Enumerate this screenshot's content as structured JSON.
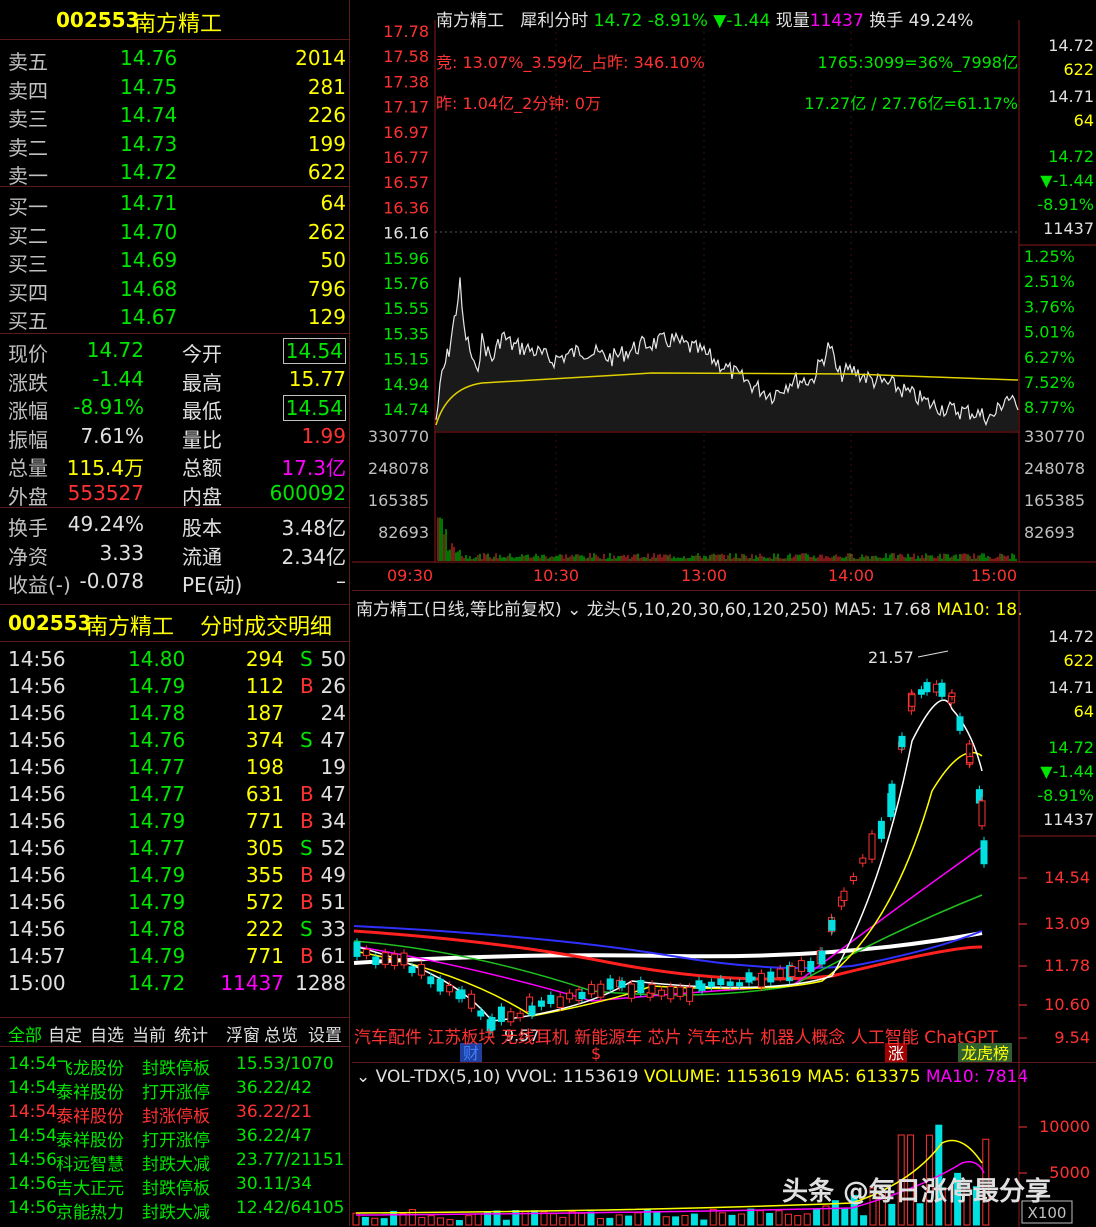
{
  "stock": {
    "code": "002553",
    "name": "南方精工"
  },
  "orderbook": {
    "asks": [
      {
        "label": "卖五",
        "price": "14.76",
        "vol": "2014"
      },
      {
        "label": "卖四",
        "price": "14.75",
        "vol": "281"
      },
      {
        "label": "卖三",
        "price": "14.74",
        "vol": "226"
      },
      {
        "label": "卖二",
        "price": "14.73",
        "vol": "199"
      },
      {
        "label": "卖一",
        "price": "14.72",
        "vol": "622"
      }
    ],
    "bids": [
      {
        "label": "买一",
        "price": "14.71",
        "vol": "64"
      },
      {
        "label": "买二",
        "price": "14.70",
        "vol": "262"
      },
      {
        "label": "买三",
        "price": "14.69",
        "vol": "50"
      },
      {
        "label": "买四",
        "price": "14.68",
        "vol": "796"
      },
      {
        "label": "买五",
        "price": "14.67",
        "vol": "129"
      }
    ]
  },
  "quote": [
    {
      "l1": "现价",
      "v1": "14.72",
      "l2": "今开",
      "v2": "14.54"
    },
    {
      "l1": "涨跌",
      "v1": "-1.44",
      "l2": "最高",
      "v2": "15.77"
    },
    {
      "l1": "涨幅",
      "v1": "-8.91%",
      "l2": "最低",
      "v2": "14.54"
    },
    {
      "l1": "振幅",
      "v1": "7.61%",
      "l2": "量比",
      "v2": "1.99"
    },
    {
      "l1": "总量",
      "v1": "115.4万",
      "l2": "总额",
      "v2": "17.3亿"
    },
    {
      "l1": "外盘",
      "v1": "553527",
      "l2": "内盘",
      "v2": "600092"
    },
    {
      "l1": "换手",
      "v1": "49.24%",
      "l2": "股本",
      "v2": "3.48亿"
    },
    {
      "l1": "净资",
      "v1": "3.33",
      "l2": "流通",
      "v2": "2.34亿"
    },
    {
      "l1": "收益(-)",
      "v1": "-0.078",
      "l2": "PE(动)",
      "v2": "–"
    }
  ],
  "ticks_header": {
    "code": "002553",
    "name": "南方精工",
    "title": "分时成交明细"
  },
  "ticks": [
    {
      "t": "14:56",
      "p": "14.80",
      "v": "294",
      "bs": "S",
      "n": "50"
    },
    {
      "t": "14:56",
      "p": "14.79",
      "v": "112",
      "bs": "B",
      "n": "26"
    },
    {
      "t": "14:56",
      "p": "14.78",
      "v": "187",
      "bs": "",
      "n": "24"
    },
    {
      "t": "14:56",
      "p": "14.76",
      "v": "374",
      "bs": "S",
      "n": "47"
    },
    {
      "t": "14:56",
      "p": "14.77",
      "v": "198",
      "bs": "",
      "n": "19"
    },
    {
      "t": "14:56",
      "p": "14.77",
      "v": "631",
      "bs": "B",
      "n": "47"
    },
    {
      "t": "14:56",
      "p": "14.79",
      "v": "771",
      "bs": "B",
      "n": "34"
    },
    {
      "t": "14:56",
      "p": "14.77",
      "v": "305",
      "bs": "S",
      "n": "52"
    },
    {
      "t": "14:56",
      "p": "14.79",
      "v": "355",
      "bs": "B",
      "n": "49"
    },
    {
      "t": "14:56",
      "p": "14.79",
      "v": "572",
      "bs": "B",
      "n": "51"
    },
    {
      "t": "14:56",
      "p": "14.78",
      "v": "222",
      "bs": "S",
      "n": "33"
    },
    {
      "t": "14:57",
      "p": "14.79",
      "v": "771",
      "bs": "B",
      "n": "61"
    },
    {
      "t": "15:00",
      "p": "14.72",
      "v": "11437",
      "bs": "",
      "n": "1288"
    }
  ],
  "tabs": [
    "全部",
    "自定",
    "自选",
    "当前",
    "统计",
    "浮窗",
    "总览",
    "设置"
  ],
  "alerts": [
    {
      "t": "14:54",
      "name": "飞龙股份",
      "ev": "封跌停板",
      "val": "15.53/1070",
      "c": "green"
    },
    {
      "t": "14:54",
      "name": "泰祥股份",
      "ev": "打开涨停",
      "val": "36.22/42",
      "c": "green"
    },
    {
      "t": "14:54",
      "name": "泰祥股份",
      "ev": "封涨停板",
      "val": "36.22/21",
      "c": "red"
    },
    {
      "t": "14:54",
      "name": "泰祥股份",
      "ev": "打开涨停",
      "val": "36.22/47",
      "c": "green"
    },
    {
      "t": "14:56",
      "name": "科远智慧",
      "ev": "封跌大减",
      "val": "23.77/21151",
      "c": "green"
    },
    {
      "t": "14:56",
      "name": "吉大正元",
      "ev": "封跌停板",
      "val": "30.11/34",
      "c": "green"
    },
    {
      "t": "14:56",
      "name": "京能热力",
      "ev": "封跌大减",
      "val": "12.42/64105",
      "c": "green"
    }
  ],
  "intraday": {
    "header": {
      "name": "南方精工",
      "mode": "犀利分时",
      "price": "14.72",
      "pct": "-8.91%",
      "chg": "▼-1.44",
      "vol_label": "现量",
      "vol": "11437",
      "turn_label": "换手",
      "turn": "49.24%"
    },
    "info1": "竞: 13.07%_3.59亿_占昨: 346.10%",
    "info2": "昨: 1.04亿_2分钟: 0万",
    "info3": "1765:3099=36%_7998亿",
    "info4": "17.27亿 / 27.76亿=61.17%",
    "y_left": [
      "17.78",
      "17.58",
      "17.38",
      "17.17",
      "16.97",
      "16.77",
      "16.57",
      "16.36",
      "16.16",
      "15.96",
      "15.76",
      "15.55",
      "15.35",
      "15.15",
      "14.94",
      "14.74"
    ],
    "y_right": [
      "1.25%",
      "2.51%",
      "3.76%",
      "5.01%",
      "6.27%",
      "7.52%",
      "8.77%"
    ],
    "vol_ticks": [
      "330770",
      "248078",
      "165385",
      "82693"
    ],
    "x_ticks": [
      "09:30",
      "10:30",
      "13:00",
      "14:00",
      "15:00"
    ],
    "side": [
      "14.72",
      "622",
      "14.71",
      "64",
      "14.72",
      "▼-1.44",
      "-8.91%",
      "11437"
    ]
  },
  "daily": {
    "header": {
      "name": "南方精工(日线,等比前复权)",
      "ma_label": "龙头(5,10,20,30,60,120,250)",
      "ma5": "MA5: 17.68",
      "ma10": "MA10: 18."
    },
    "high_note": "21.57",
    "low_note": "9.57",
    "y_ticks": [
      "14.54",
      "13.09",
      "11.78",
      "10.60",
      "9.54"
    ],
    "concepts": "汽车配件 江苏板块 无线耳机 新能源车 芯片 汽车芯片 机器人概念 人工智能 ChatGPT",
    "markers": [
      "财",
      "$",
      "涨",
      "龙虎榜"
    ],
    "side": [
      "14.72",
      "622",
      "14.71",
      "64",
      "14.72",
      "▼-1.44",
      "-8.91%",
      "11437"
    ]
  },
  "volume": {
    "header": "VOL-TDX(5,10)",
    "vvol": "VVOL: 1153619",
    "volume": "VOLUME: 1153619",
    "ma5": "MA5: 613375",
    "ma10": "MA10: 7814",
    "y_ticks": [
      "10000",
      "5000"
    ],
    "unit": "X100"
  },
  "watermark": "头条 @每日涨停最分享"
}
